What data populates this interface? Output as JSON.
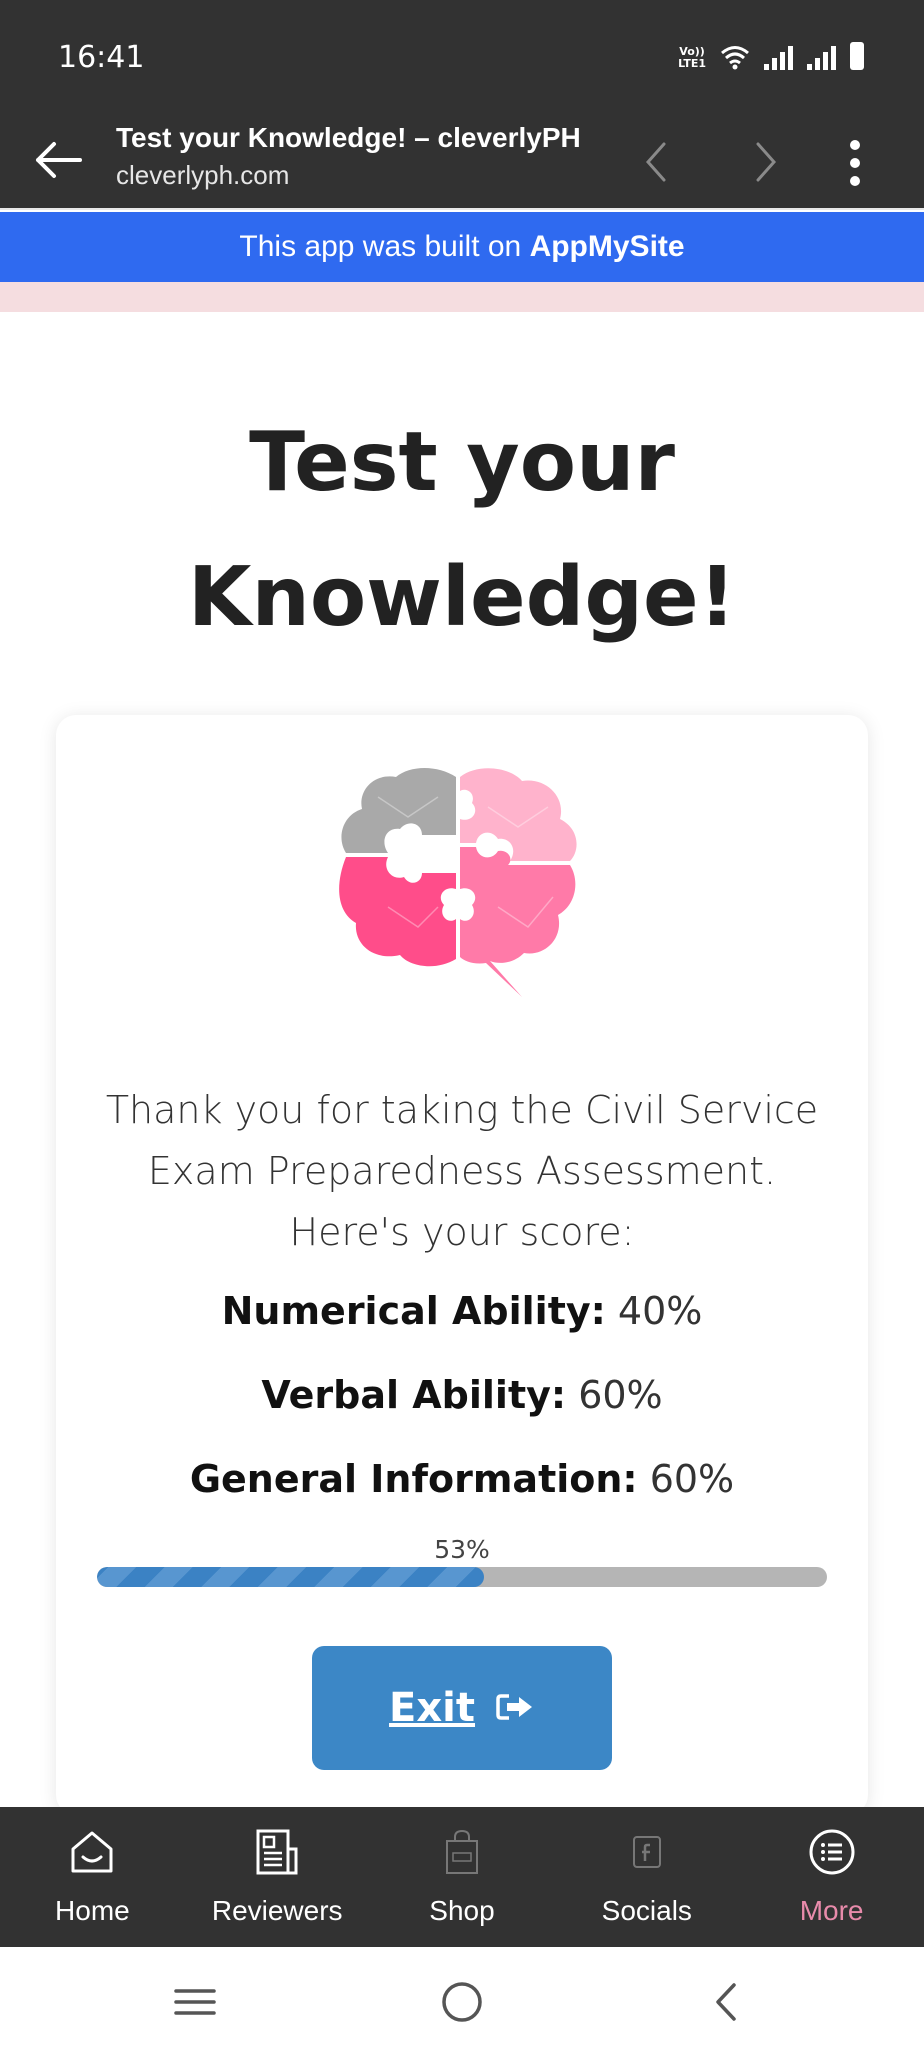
{
  "status_bar": {
    "time": "16:41",
    "volte_top": "Vo))",
    "volte_bottom": "LTE1",
    "icons": [
      "volte-icon",
      "wifi-icon",
      "signal-icon",
      "signal-icon",
      "battery-icon"
    ]
  },
  "browser": {
    "title": "Test your Knowledge! – cleverlyPH",
    "url": "cleverlyph.com"
  },
  "banner": {
    "prefix": "This app was built on ",
    "brand": "AppMySite",
    "color": "#2f6af0"
  },
  "page": {
    "title_line1": "Test your",
    "title_line2": "Knowledge!"
  },
  "result": {
    "intro_line1": "Thank you for taking the Civil Service",
    "intro_line2": "Exam Preparedness Assessment.",
    "intro_line3": "Here's your score:",
    "scores": [
      {
        "label": "Numerical Ability:",
        "value": "40%"
      },
      {
        "label": "Verbal Ability:",
        "value": "60%"
      },
      {
        "label": "General Information:",
        "value": "60%"
      }
    ],
    "progress_label": "53%",
    "progress_value": 0.53,
    "exit_label": "Exit",
    "accent_color": "#3c87c6"
  },
  "bottom_nav": {
    "items": [
      {
        "label": "Home",
        "icon": "home-icon"
      },
      {
        "label": "Reviewers",
        "icon": "newspaper-icon"
      },
      {
        "label": "Shop",
        "icon": "shop-bag-icon"
      },
      {
        "label": "Socials",
        "icon": "facebook-icon"
      },
      {
        "label": "More",
        "icon": "menu-list-icon",
        "active": true
      }
    ],
    "active_color": "#e88bab"
  }
}
